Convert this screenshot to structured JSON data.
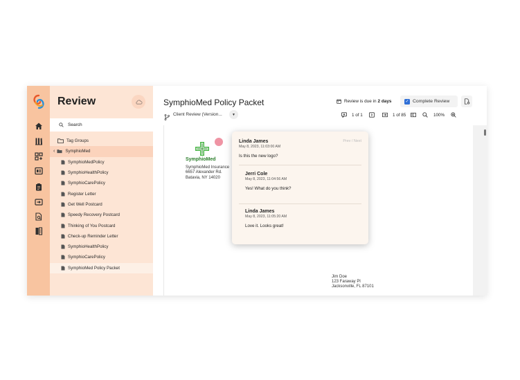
{
  "panel": {
    "title": "Review",
    "search_label": "Search",
    "tag_groups": "Tag Groups",
    "folder": "SymphioMed",
    "items": [
      {
        "label": "SymphioMedPolicy"
      },
      {
        "label": "SymphioHealthPolicy"
      },
      {
        "label": "SymphioCarePolicy"
      },
      {
        "label": "Register Letter"
      },
      {
        "label": "Get Well Postcard"
      },
      {
        "label": "Speedy Recovery Postcard"
      },
      {
        "label": "Thinking of You Postcard"
      },
      {
        "label": "Check-up Reminder Letter"
      },
      {
        "label": "SymphioHealthPolicy"
      },
      {
        "label": "SymphioCarePolicy"
      },
      {
        "label": "SymphioMed Policy Packet"
      }
    ]
  },
  "header": {
    "title": "SymphioMed Policy Packet",
    "version_label": "Client Review (Version...",
    "due_prefix": "Review is due in",
    "due_value": "2 days",
    "complete_label": "Complete Review",
    "complete_checked": true,
    "comment_counter": "1 of 1",
    "page_counter": "1 of 85",
    "zoom": "100%"
  },
  "document": {
    "company_name": "SymphioMed",
    "sender_lines": [
      "SymphioMed Insurance",
      "6657 Alexander Rd.",
      "Batavia, NY 14020"
    ],
    "recipient_lines": [
      "Jim Doe",
      "123 Faraway Pl",
      "Jacksonville, FL 87101"
    ]
  },
  "comments": {
    "nav_prev": "Prev",
    "nav_sep": "/",
    "nav_next": "Next",
    "items": [
      {
        "name": "Linda James",
        "time": "May 8, 2023, 11:03:00 AM",
        "text": "Is this the new logo?"
      },
      {
        "name": "Jerri Cole",
        "time": "May 8, 2023, 11:04:56 AM",
        "text": "Yes! What do you think?"
      },
      {
        "name": "Linda James",
        "time": "May 8, 2023, 11:05:20 AM",
        "text": "Love it. Looks great!"
      }
    ]
  },
  "colors": {
    "rail": "#f8c4a0",
    "panel": "#fde5d5",
    "selected_row": "#fbd3bc",
    "accent_blue": "#2f6fd6",
    "logo_green": "#2a7d2a"
  },
  "icons": [
    "app-logo-icon",
    "home-icon",
    "library-icon",
    "add-widget-icon",
    "layout-icon",
    "clipboard-icon",
    "import-icon",
    "document-search-icon",
    "compare-icon"
  ]
}
